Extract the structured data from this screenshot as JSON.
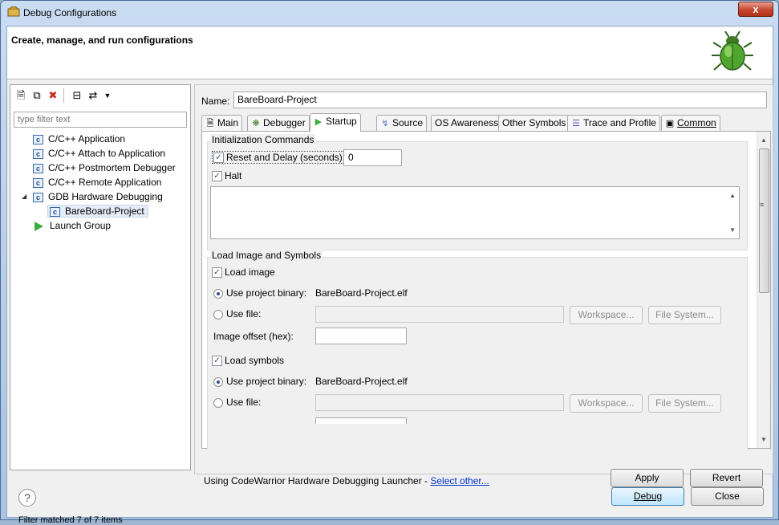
{
  "window": {
    "title": "Debug Configurations",
    "close_glyph": "x"
  },
  "header": {
    "title": "Create, manage, and run configurations",
    "icon": "bug-icon"
  },
  "left": {
    "filter_placeholder": "type filter text",
    "tree": [
      {
        "label": "C/C++ Application",
        "icon": "c-icon"
      },
      {
        "label": "C/C++ Attach to Application",
        "icon": "c-icon"
      },
      {
        "label": "C/C++ Postmortem Debugger",
        "icon": "c-icon"
      },
      {
        "label": "C/C++ Remote Application",
        "icon": "c-icon"
      },
      {
        "label": "GDB Hardware Debugging",
        "icon": "c-icon",
        "expanded": true
      },
      {
        "label": "BareBoard-Project",
        "icon": "c-icon",
        "selected": true
      },
      {
        "label": "Launch Group",
        "icon": "launch-icon"
      }
    ],
    "status": "Filter matched 7 of 7 items"
  },
  "right": {
    "name_label": "Name:",
    "name_value": "BareBoard-Project",
    "tabs": [
      "Main",
      "Debugger",
      "Startup",
      "Source",
      "OS Awareness",
      "Other Symbols",
      "Trace and Profile",
      "Common"
    ],
    "active_tab": "Startup",
    "init": {
      "title": "Initialization Commands",
      "reset_label": "Reset and Delay (seconds):",
      "reset_value": "0",
      "halt_label": "Halt"
    },
    "load": {
      "title": "Load Image and Symbols",
      "load_image_label": "Load image",
      "use_project_binary_label": "Use project binary:",
      "project_binary_value": "BareBoard-Project.elf",
      "use_file_label": "Use file:",
      "workspace_label": "Workspace...",
      "filesystem_label": "File System...",
      "image_offset_label": "Image offset (hex):",
      "load_symbols_label": "Load symbols"
    },
    "launcher_text": "Using CodeWarrior Hardware Debugging Launcher - ",
    "launcher_link": "Select other...",
    "apply_label": "Apply",
    "revert_label": "Revert"
  },
  "footer": {
    "help_glyph": "?",
    "debug_label": "Debug",
    "close_label": "Close"
  },
  "colors": {
    "accent": "#3c7fb1",
    "launch_green": "#3cae3c",
    "link": "#0033cc"
  }
}
